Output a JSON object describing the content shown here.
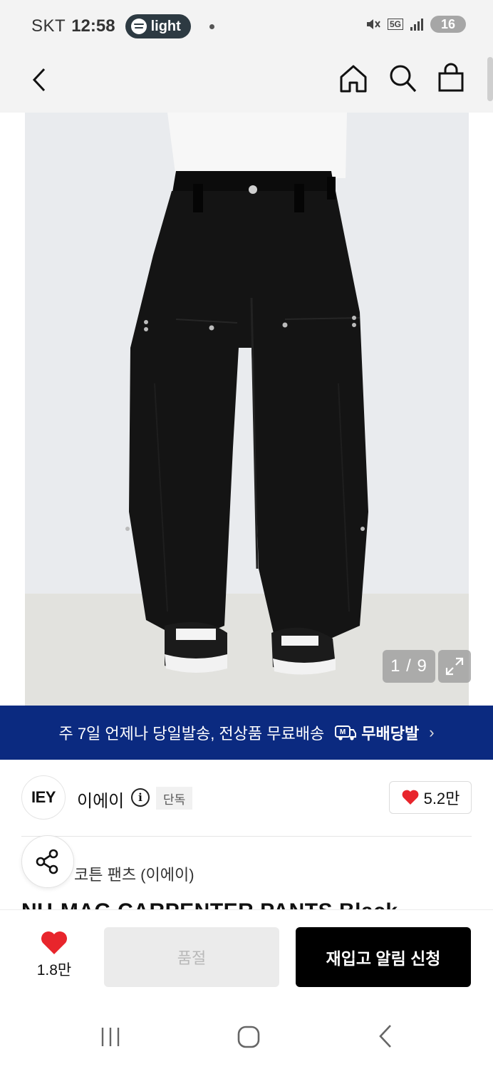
{
  "status_bar": {
    "carrier": "SKT",
    "time": "12:58",
    "spotify_label": "light",
    "network": "5G",
    "battery": "16"
  },
  "header": {
    "back_icon": "chevron-left-icon",
    "home_icon": "home-icon",
    "search_icon": "search-icon",
    "bag_icon": "shopping-bag-icon"
  },
  "gallery": {
    "counter": "1 / 9",
    "current_index": 1,
    "total": 9,
    "expand_icon": "expand-icon"
  },
  "promo": {
    "text": "주 7일 언제나 당일발송, 전상품 무료배송",
    "badge": "무배당발",
    "chevron": "›"
  },
  "brand": {
    "logo_text": "IEY",
    "name": "이에이",
    "exclusive_badge": "단독",
    "like_count": "5.2만"
  },
  "product": {
    "category_line": "코튼 팬츠 (이에이)",
    "title": "NU-MAG CARPENTER PANTS Black"
  },
  "actions": {
    "wish_count": "1.8만",
    "soldout_label": "품절",
    "restock_label": "재입고 알림 신청"
  },
  "colors": {
    "banner_bg": "#0b2a80",
    "heart": "#e8252c",
    "restock_bg": "#000000",
    "soldout_bg": "#ebebeb"
  }
}
